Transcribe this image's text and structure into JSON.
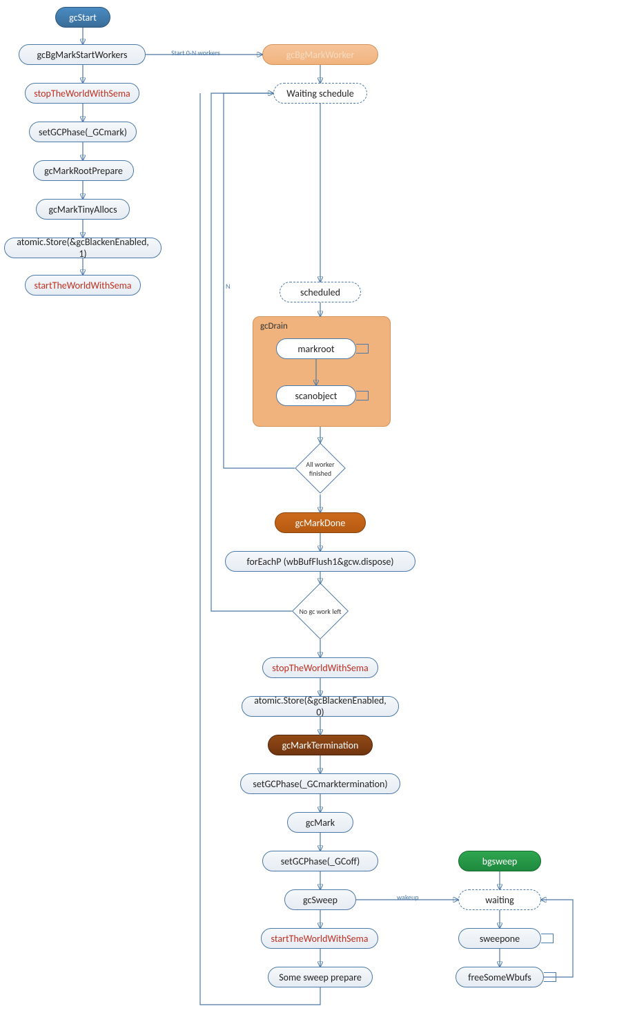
{
  "left_chain": {
    "start": "gcStart",
    "n1": "gcBgMarkStartWorkers",
    "n2": "stopTheWorldWithSema",
    "n3": "setGCPhase(_GCmark)",
    "n4": "gcMarkRootPrepare",
    "n5": "gcMarkTinyAllocs",
    "n6": "atomic.Store(&gcBlackenEnabled, 1)",
    "n7": "startTheWorldWithSema"
  },
  "right_chain": {
    "worker": "gcBgMarkWorker",
    "waiting": "Waiting schedule",
    "scheduled": "scheduled",
    "gcdrain_label": "gcDrain",
    "markroot": "markroot",
    "scanobject": "scanobject",
    "diamond1": "All worker\nfinished",
    "markdone": "gcMarkDone",
    "foreach": "forEachP (wbBufFlush1&gcw.dispose)",
    "diamond2": "No gc work left",
    "stop2": "stopTheWorldWithSema",
    "atomic0": "atomic.Store(&gcBlackenEnabled, 0)",
    "markterm": "gcMarkTermination",
    "setphase_term": "setGCPhase(_GCmarktermination)",
    "gcmark": "gcMark",
    "setphase_off": "setGCPhase(_GCoff)",
    "gcsweep": "gcSweep",
    "start2": "startTheWorldWithSema",
    "prepare": "Some sweep prepare"
  },
  "bgsweep": {
    "start": "bgsweep",
    "waiting": "waiting",
    "sweepone": "sweepone",
    "freewbufs": "freeSomeWbufs"
  },
  "edge_labels": {
    "start_workers": "Start 0-N workers",
    "n": "N",
    "wakeup": "wakeup"
  }
}
